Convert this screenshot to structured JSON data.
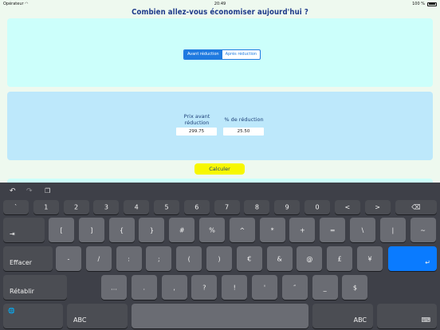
{
  "status": {
    "carrier": "Opérateur",
    "time": "20:49",
    "battery": "100 %"
  },
  "title": "Combien allez-vous économiser aujourd'hui ?",
  "segment": {
    "options": [
      "Avant réduction",
      "Après réduction"
    ],
    "selected": 0
  },
  "fields": {
    "price_label": "Prix avant réduction",
    "price_value": "299.75",
    "discount_label": "% de réduction",
    "discount_value": "25.50"
  },
  "calc_button": "Calculer",
  "keyboard": {
    "row1": [
      "`",
      "1",
      "2",
      "3",
      "4",
      "5",
      "6",
      "7",
      "8",
      "9",
      "0",
      "<",
      ">"
    ],
    "row2": [
      "[",
      "]",
      "{",
      "}",
      "#",
      "%",
      "^",
      "*",
      "+",
      "=",
      "\\",
      "|",
      "~"
    ],
    "row3": [
      "-",
      "/",
      ":",
      ";",
      "(",
      ")",
      "€",
      "&",
      "@",
      "£",
      "¥"
    ],
    "row4": [
      "…",
      ".",
      ",",
      "?",
      "!",
      "'",
      "″",
      "_",
      "$"
    ],
    "tab_symbol": "⇥",
    "delete_symbol": "⌫",
    "effacer": "Effacer",
    "retablir": "Rétablir",
    "abc": "ABC",
    "globe": "🌐",
    "return_symbol": "↵",
    "undo": "↶",
    "redo": "↷",
    "paste": "❐",
    "hide_keyboard": "⌨"
  }
}
